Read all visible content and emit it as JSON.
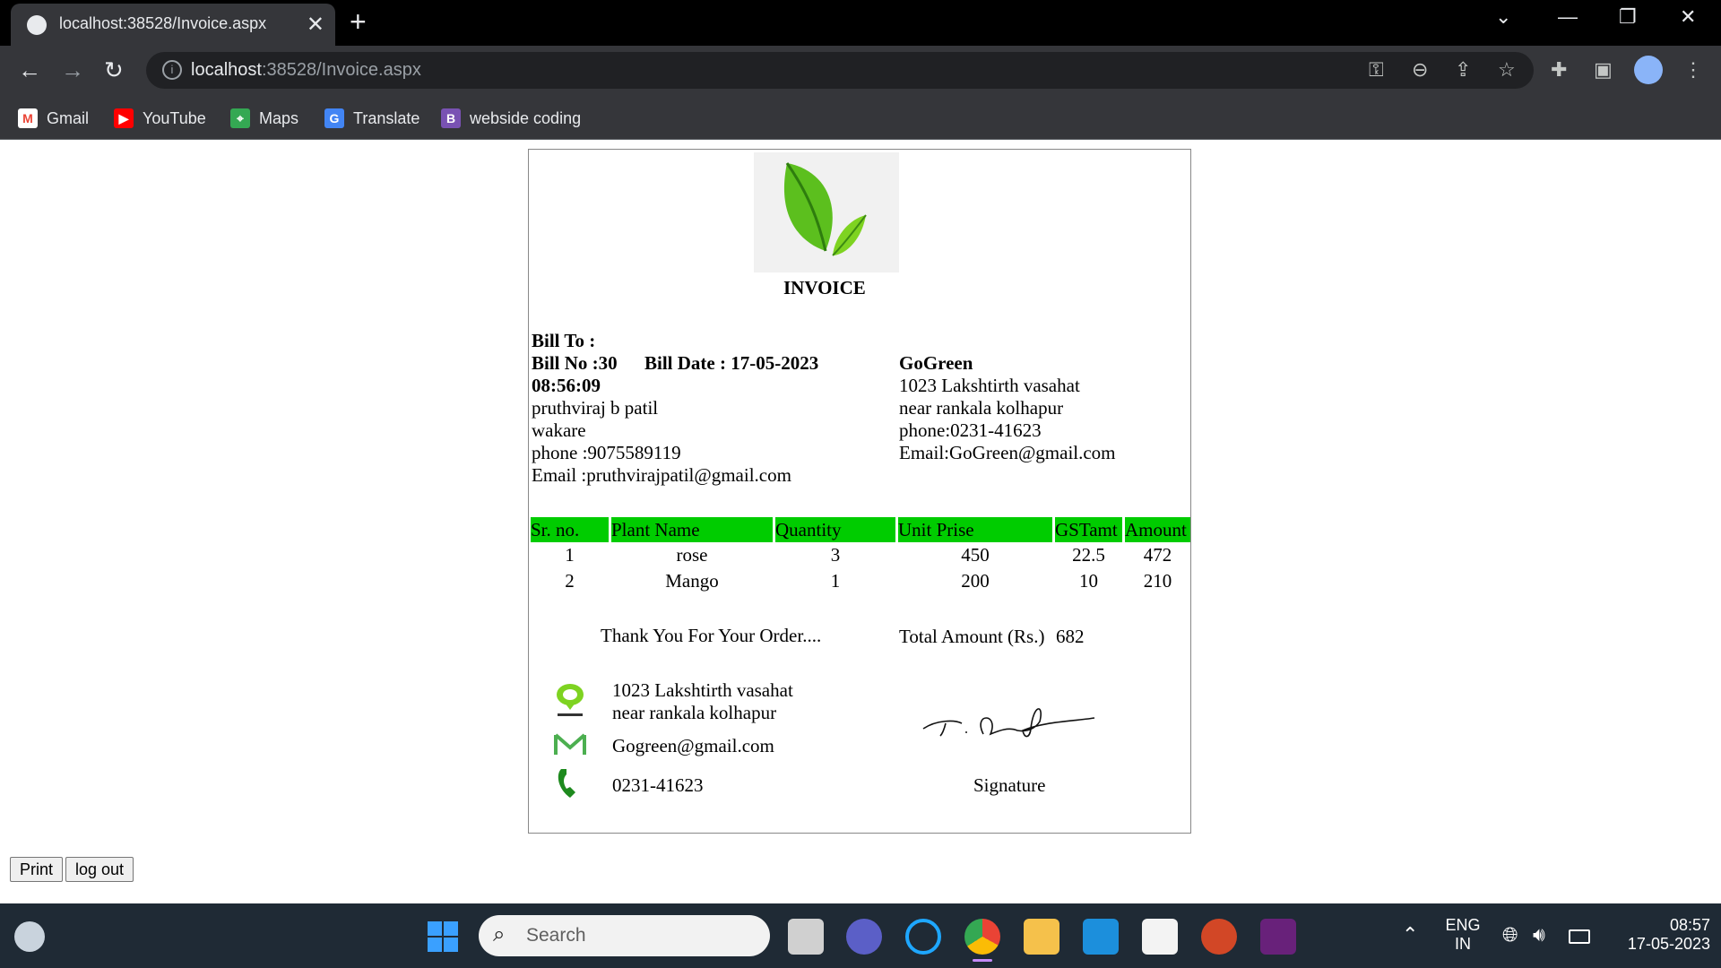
{
  "browser": {
    "tab_title": "localhost:38528/Invoice.aspx",
    "url_host": "localhost",
    "url_path": ":38528/Invoice.aspx",
    "bookmarks": [
      {
        "label": "Gmail",
        "icon": "gmail-icon"
      },
      {
        "label": "YouTube",
        "icon": "youtube-icon"
      },
      {
        "label": "Maps",
        "icon": "maps-icon"
      },
      {
        "label": "Translate",
        "icon": "translate-icon"
      },
      {
        "label": "webside coding",
        "icon": "bootstrap-icon"
      }
    ]
  },
  "invoice": {
    "heading": "INVOICE",
    "bill_to_label": "Bill To :",
    "bill_no": "Bill No :30",
    "bill_date": "Bill Date : 17-05-2023",
    "bill_time": "08:56:09",
    "customer": {
      "name": "pruthviraj b patil",
      "address": "wakare",
      "phone": "phone :9075589119",
      "email": "Email :pruthvirajpatil@gmail.com"
    },
    "company": {
      "name": "GoGreen",
      "address1": "1023 Lakshtirth vasahat",
      "address2": "near rankala kolhapur",
      "phone": "phone:0231-41623",
      "email": "Email:GoGreen@gmail.com"
    },
    "table": {
      "headers": [
        "Sr. no.",
        "Plant Name",
        "Quantity",
        "Unit Prise",
        "GSTamt",
        "Amount"
      ],
      "rows": [
        [
          "1",
          "rose",
          "3",
          "450",
          "22.5",
          "472"
        ],
        [
          "2",
          "Mango",
          "1",
          "200",
          "10",
          "210"
        ]
      ]
    },
    "thank_you": "Thank You For Your Order....",
    "total_label": "Total Amount (Rs.)",
    "total_value": "682",
    "footer": {
      "address1": "1023 Lakshtirth vasahat",
      "address2": "near rankala kolhapur",
      "email": "Gogreen@gmail.com",
      "phone": "0231-41623",
      "signature_label": "Signature"
    },
    "accent_color": "#00cc00"
  },
  "page_buttons": {
    "print": "Print",
    "logout": "log out"
  },
  "taskbar": {
    "search_placeholder": "Search",
    "lang_line1": "ENG",
    "lang_line2": "IN",
    "time": "08:57",
    "date": "17-05-2023"
  }
}
